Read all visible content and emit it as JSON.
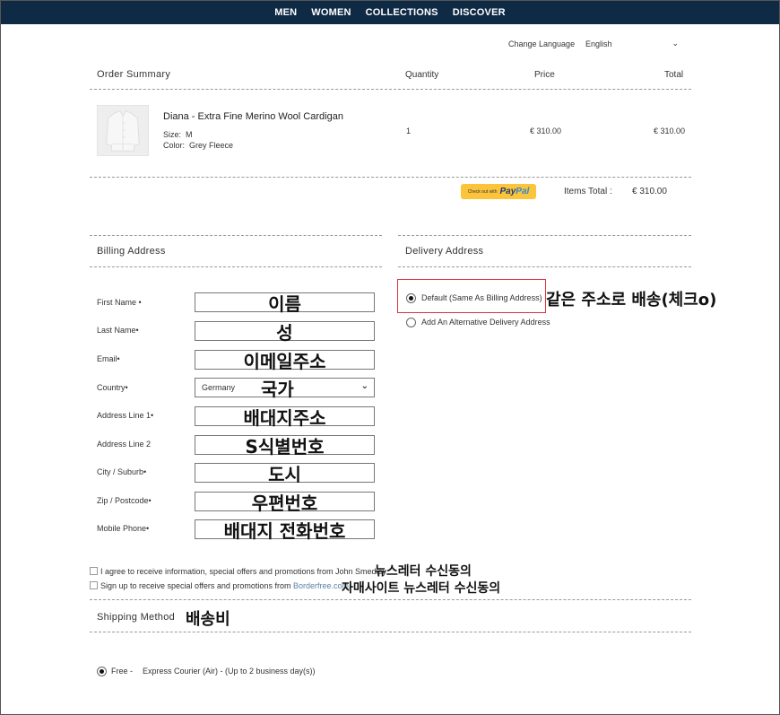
{
  "nav": [
    "MEN",
    "WOMEN",
    "COLLECTIONS",
    "DISCOVER"
  ],
  "language": {
    "label": "Change Language",
    "value": "English"
  },
  "order": {
    "title": "Order Summary",
    "columns": {
      "quantity": "Quantity",
      "price": "Price",
      "total": "Total"
    },
    "item": {
      "name": "Diana - Extra Fine Merino Wool Cardigan",
      "size_label": "Size:",
      "size_value": "M",
      "color_label": "Color:",
      "color_value": "Grey Fleece",
      "quantity": "1",
      "price": "€ 310.00",
      "total": "€ 310.00"
    },
    "paypal": {
      "small": "Check out with",
      "pay": "Pay",
      "pal": "Pal"
    },
    "items_total_label": "Items Total :",
    "items_total_value": "€ 310.00"
  },
  "billing": {
    "title": "Billing Address",
    "fields": [
      {
        "label": "First Name •",
        "annotation": "이름"
      },
      {
        "label": "Last Name•",
        "annotation": "성"
      },
      {
        "label": "Email•",
        "annotation": "이메일주소"
      },
      {
        "label": "Country•",
        "value": "Germany",
        "annotation": "국가"
      },
      {
        "label": "Address Line 1•",
        "annotation": "배대지주소"
      },
      {
        "label": "Address Line 2",
        "annotation": "S식별번호"
      },
      {
        "label": "City / Suburb•",
        "annotation": "도시"
      },
      {
        "label": "Zip / Postcode•",
        "annotation": "우편번호"
      },
      {
        "label": "Mobile Phone•",
        "annotation": "배대지 전화번호"
      }
    ]
  },
  "delivery": {
    "title": "Delivery Address",
    "option_default": "Default (Same As Billing Address)",
    "option_alt": "Add An Alternative Delivery Address",
    "annotation": "같은 주소로 배송(체크o)"
  },
  "consents": {
    "agree_text": "I agree to receive information, special offers and promotions from John Smedley",
    "agree_annotation": "뉴스레터 수신동의",
    "signup_text": "Sign up to receive special offers and promotions from ",
    "signup_link": "Borderfree.com",
    "signup_end": ".",
    "signup_annotation": "자매사이트 뉴스레터 수신동의"
  },
  "shipping": {
    "title": "Shipping Method",
    "annotation": "배송비",
    "option_price": "Free -",
    "option_desc": "Express Courier (Air) - (Up to 2 business day(s))"
  },
  "colors": {
    "nav_bg": "#0f2a45",
    "paypal": "#fcc43a",
    "highlight": "#d9333f"
  }
}
